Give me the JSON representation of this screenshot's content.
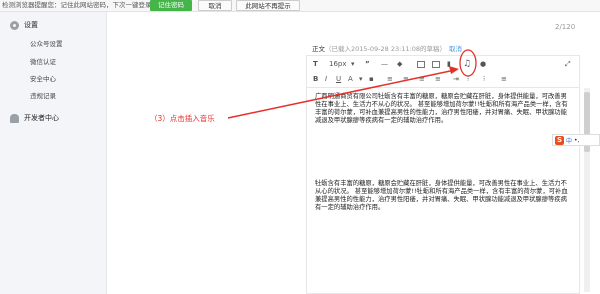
{
  "topbar": {
    "message": "检测浏览器提醒您：记住此网站密码，下次一键登录！",
    "remember_label": "记住密码",
    "cancel_label": "取消",
    "never_label": "此网站不再提示"
  },
  "sidebar": {
    "settings_title": "设置",
    "items": [
      {
        "label": "公众号设置"
      },
      {
        "label": "微信认证"
      },
      {
        "label": "安全中心"
      },
      {
        "label": "违规记录"
      }
    ],
    "developer_title": "开发者中心"
  },
  "editor": {
    "char_count": "2/120",
    "body_label": "正文",
    "loaded_text": "（已载入2015-09-28 23:11:08的草稿）",
    "cancel_label": "取消",
    "font_size": "16px",
    "paragraph1": "广西明通商贸有限公司牡蛎含有丰富的糖原，糖原会贮藏在肝脏，身体提供能量，可改善男性在事业上、生活力不从心的状况。 甚至能够增加荷尔蒙!!牡蛎和所有海产品类一样，含有丰富的荷尔蒙，可补血兼提高男性的性能力，治疗男性阳痿，并对胃痛、失眠、甲状腺功能减退及甲状腺瘳等疾病有一定的辅助治疗作用。",
    "paragraph2": "牡蛎含有丰富的糖原，糖原会贮藏在肝脏，身体提供能量，可改善男性在事业上、生活力不从心的状况。 甚至能够增加荷尔蒙!!牡蛎和所有海产品类一样，含有丰富的荷尔蒙，可补血兼提高男性的性能力，治疗男性阳痿，并对胃痛、失眠、甲状腺功能减退及甲状腺瘳等疾病有一定的辅助治疗作用。"
  },
  "annotation": {
    "text": "（3）点击插入音乐"
  },
  "ime": {
    "mode": "中"
  },
  "colors": {
    "green": "#44b549",
    "annotation_red": "#e5302a",
    "link_blue": "#459ae9"
  }
}
